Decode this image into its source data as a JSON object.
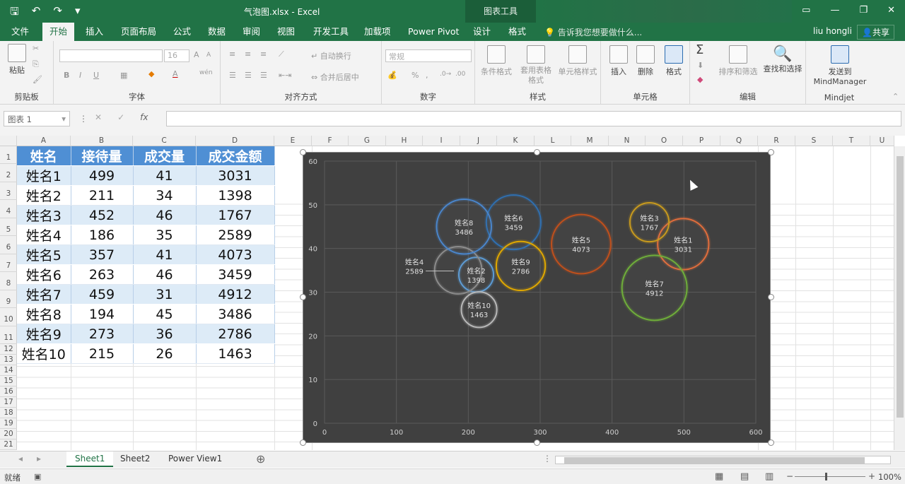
{
  "titlebar": {
    "filename": "气泡图.xlsx - Excel",
    "context_tool": "图表工具",
    "qat": {
      "save": "🖫",
      "undo": "↶",
      "redo": "↷",
      "customize": "▾"
    },
    "window": {
      "ribbon_display": "▭",
      "minimize": "—",
      "restore": "❐",
      "close": "✕"
    }
  },
  "tabs": [
    "文件",
    "开始",
    "插入",
    "页面布局",
    "公式",
    "数据",
    "审阅",
    "视图",
    "开发工具",
    "加载项",
    "Power Pivot",
    "设计",
    "格式"
  ],
  "active_tab": "开始",
  "tell_me": "告诉我您想要做什么...",
  "user": "liu hongli",
  "share": "共享",
  "ribbon": {
    "clipboard": {
      "paste": "粘贴",
      "label": "剪贴板"
    },
    "font": {
      "name": "",
      "size": "16",
      "label": "字体",
      "bold": "B",
      "italic": "I",
      "underline": "U",
      "grow": "A",
      "shrink": "A",
      "color": "A",
      "wen": "wén"
    },
    "alignment": {
      "wrap": "自动换行",
      "merge": "合并后居中",
      "label": "对齐方式"
    },
    "number": {
      "format": "常规",
      "label": "数字",
      "percent": "%",
      "comma": ","
    },
    "styles": {
      "conditional": "条件格式",
      "table": "套用表格格式",
      "cell_styles": "单元格样式",
      "label": "样式"
    },
    "cells": {
      "insert": "插入",
      "delete": "删除",
      "format": "格式",
      "label": "单元格"
    },
    "editing": {
      "sort": "排序和筛选",
      "find": "查找和选择",
      "label": "编辑",
      "sum": "Σ"
    },
    "mindjet": {
      "send": "发送到",
      "product": "MindManager",
      "label": "Mindjet"
    }
  },
  "formula_bar": {
    "name_box": "图表 1",
    "cancel": "✕",
    "enter": "✓",
    "fx": "fx",
    "formula": ""
  },
  "columns": [
    "A",
    "B",
    "C",
    "D",
    "E",
    "F",
    "G",
    "H",
    "I",
    "J",
    "K",
    "L",
    "M",
    "N",
    "O",
    "P",
    "Q",
    "R",
    "S",
    "T",
    "U"
  ],
  "rows": [
    "1",
    "2",
    "3",
    "4",
    "5",
    "6",
    "7",
    "8",
    "9",
    "10",
    "11",
    "12",
    "13",
    "14",
    "15",
    "16",
    "17",
    "18",
    "19",
    "20",
    "21"
  ],
  "table": {
    "headers": [
      "姓名",
      "接待量",
      "成交量",
      "成交金额"
    ],
    "rows": [
      [
        "姓名1",
        "499",
        "41",
        "3031"
      ],
      [
        "姓名2",
        "211",
        "34",
        "1398"
      ],
      [
        "姓名3",
        "452",
        "46",
        "1767"
      ],
      [
        "姓名4",
        "186",
        "35",
        "2589"
      ],
      [
        "姓名5",
        "357",
        "41",
        "4073"
      ],
      [
        "姓名6",
        "263",
        "46",
        "3459"
      ],
      [
        "姓名7",
        "459",
        "31",
        "4912"
      ],
      [
        "姓名8",
        "194",
        "45",
        "3486"
      ],
      [
        "姓名9",
        "273",
        "36",
        "2786"
      ],
      [
        "姓名10",
        "215",
        "26",
        "1463"
      ]
    ]
  },
  "chart_data": {
    "type": "scatter",
    "subtype": "bubble",
    "title": "",
    "xlabel": "",
    "ylabel": "",
    "xlim": [
      0,
      600
    ],
    "ylim": [
      0,
      60
    ],
    "x_ticks": [
      "0",
      "100",
      "200",
      "300",
      "400",
      "500",
      "600"
    ],
    "y_ticks": [
      "0",
      "10",
      "20",
      "30",
      "40",
      "50",
      "60"
    ],
    "grid": true,
    "background": "#404040",
    "points": [
      {
        "label": "姓名1",
        "x": 499,
        "y": 41,
        "size": 3031,
        "color": "#e06d3c"
      },
      {
        "label": "姓名2",
        "x": 211,
        "y": 34,
        "size": 1398,
        "color": "#5b9bd5"
      },
      {
        "label": "姓名3",
        "x": 452,
        "y": 46,
        "size": 1767,
        "color": "#c89a1e"
      },
      {
        "label": "姓名4",
        "x": 186,
        "y": 35,
        "size": 2589,
        "color": "#8c8c8c"
      },
      {
        "label": "姓名5",
        "x": 357,
        "y": 41,
        "size": 4073,
        "color": "#c0501c"
      },
      {
        "label": "姓名6",
        "x": 263,
        "y": 46,
        "size": 3459,
        "color": "#2f6fb0"
      },
      {
        "label": "姓名7",
        "x": 459,
        "y": 31,
        "size": 4912,
        "color": "#6fae3a"
      },
      {
        "label": "姓名8",
        "x": 194,
        "y": 45,
        "size": 3486,
        "color": "#4a86cc"
      },
      {
        "label": "姓名9",
        "x": 273,
        "y": 36,
        "size": 2786,
        "color": "#e0a800"
      },
      {
        "label": "姓名10",
        "x": 215,
        "y": 26,
        "size": 1463,
        "color": "#b8b8b8"
      }
    ]
  },
  "sheets": [
    "Sheet1",
    "Sheet2",
    "Power View1"
  ],
  "active_sheet": "Sheet1",
  "status": {
    "ready": "就绪",
    "zoom": "100%"
  }
}
